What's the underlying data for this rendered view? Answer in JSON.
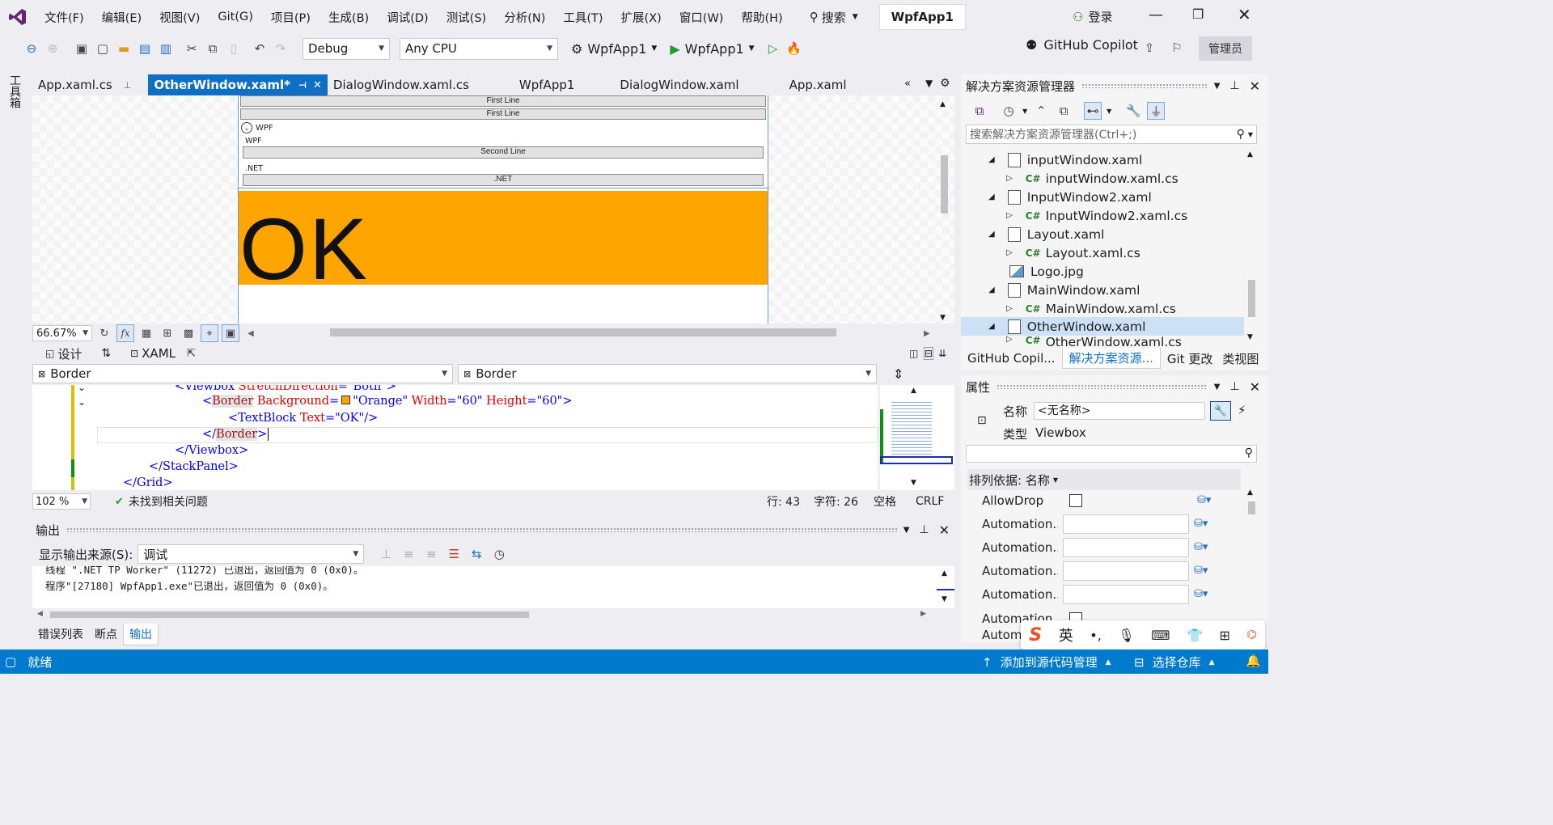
{
  "colors": {
    "accent": "#0e6fc5",
    "status_bar": "#007acc",
    "orange": "#ffa500"
  },
  "menu": [
    "文件(F)",
    "编辑(E)",
    "视图(V)",
    "Git(G)",
    "项目(P)",
    "生成(B)",
    "调试(D)",
    "测试(S)",
    "分析(N)",
    "工具(T)",
    "扩展(X)",
    "窗口(W)",
    "帮助(H)"
  ],
  "search_label": "搜索",
  "solution_name": "WpfApp1",
  "login_label": "登录",
  "toolbar": {
    "config": "Debug",
    "platform": "Any CPU",
    "startup": "WpfApp1",
    "run": "WpfApp1",
    "copilot": "GitHub Copilot",
    "admin": "管理员"
  },
  "left_rail": "工具箱",
  "tabs": [
    "App.xaml.cs",
    "OtherWindow.xaml*",
    "DialogWindow.xaml.cs",
    "WpfApp1",
    "DialogWindow.xaml",
    "App.xaml"
  ],
  "designer": {
    "btn1": "First Line",
    "btn2": "First Line",
    "expander": "WPF",
    "label_wpf": "WPF",
    "btn_second": "Second Line",
    "label_net": ".NET",
    "btn_net": ".NET",
    "ok": "OK",
    "zoom": "66.67%"
  },
  "view_tabs": {
    "design": "设计",
    "xaml": "XAML"
  },
  "element_left": "Border",
  "element_right": "Border",
  "code": {
    "l0_tag": "<Viewbox ",
    "l0_attr": "StretchDirection",
    "l0_eq": "=",
    "l0_val": "\"Both\"",
    "l0_end": ">",
    "l1_open": "<",
    "l1_tag": "Border",
    "l1_a1": " Background",
    "l1_eq": "=",
    "l1_v1": "\"Orange\"",
    "l1_a2": " Width",
    "l1_v2": "\"60\"",
    "l1_a3": " Height",
    "l1_v3": "\"60\"",
    "l1_close": ">",
    "l2_tag": "<TextBlock ",
    "l2_attr": "Text",
    "l2_eq": "=",
    "l2_val": "\"OK\"",
    "l2_close": "/>",
    "l3_open": "</",
    "l3_tag": "Border",
    "l3_close": ">",
    "l4": "</Viewbox>",
    "l5": "</StackPanel>",
    "l6": "</Grid>"
  },
  "editor_status": {
    "zoom": "102 %",
    "issues": "未找到相关问题",
    "line": "行: 43",
    "char": "字符: 26",
    "spaces": "空格",
    "eol": "CRLF"
  },
  "output": {
    "title": "输出",
    "source_label": "显示输出来源(S):",
    "source_value": "调试",
    "line1": "线程 \".NET TP Worker\" (11272) 已退出，返回值为 0 (0x0)。",
    "line2": "程序\"[27180] WpfApp1.exe\"已退出，返回值为 0 (0x0)。"
  },
  "bottom_tabs": [
    "错误列表",
    "断点",
    "输出"
  ],
  "solution": {
    "title": "解决方案资源管理器",
    "search_placeholder": "搜索解决方案资源管理器(Ctrl+;)",
    "items": [
      {
        "label": "inputWindow.xaml",
        "kind": "xaml"
      },
      {
        "label": "inputWindow.xaml.cs",
        "kind": "cs"
      },
      {
        "label": "InputWindow2.xaml",
        "kind": "xaml"
      },
      {
        "label": "InputWindow2.xaml.cs",
        "kind": "cs"
      },
      {
        "label": "Layout.xaml",
        "kind": "xaml"
      },
      {
        "label": "Layout.xaml.cs",
        "kind": "cs"
      },
      {
        "label": "Logo.jpg",
        "kind": "img"
      },
      {
        "label": "MainWindow.xaml",
        "kind": "xaml"
      },
      {
        "label": "MainWindow.xaml.cs",
        "kind": "cs"
      },
      {
        "label": "OtherWindow.xaml",
        "kind": "xaml"
      },
      {
        "label": "OtherWindow.xaml.cs",
        "kind": "cs"
      }
    ],
    "tabs": [
      "GitHub Copil...",
      "解决方案资源...",
      "Git 更改",
      "类视图"
    ]
  },
  "properties": {
    "title": "属性",
    "name_label": "名称",
    "name_value": "<无名称>",
    "type_label": "类型",
    "type_value": "Viewbox",
    "sort_label": "排列依据: 名称",
    "rows": [
      "AllowDrop",
      "Automation...",
      "Automation...",
      "Automation...",
      "Automation...",
      "Automation...",
      "Autom..."
    ]
  },
  "statusbar": {
    "ready": "就绪",
    "source_control": "添加到源代码管理",
    "repo": "选择仓库"
  },
  "ime": {
    "lang": "英"
  }
}
